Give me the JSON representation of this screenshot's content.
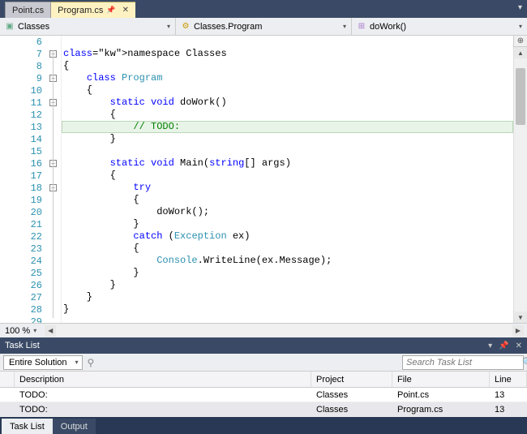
{
  "tabs": {
    "items": [
      {
        "label": "Point.cs",
        "active": false
      },
      {
        "label": "Program.cs",
        "active": true
      }
    ]
  },
  "nav": {
    "scope": "Classes",
    "class": "Classes.Program",
    "member": "doWork()"
  },
  "editor": {
    "zoom": "100 %",
    "first_line_no": 6,
    "highlight_line": 13,
    "lines": [
      {
        "n": 6,
        "raw": ""
      },
      {
        "n": 7,
        "raw": "namespace Classes",
        "outline": "-"
      },
      {
        "n": 8,
        "raw": "{"
      },
      {
        "n": 9,
        "raw": "    class Program",
        "outline": "-"
      },
      {
        "n": 10,
        "raw": "    {"
      },
      {
        "n": 11,
        "raw": "        static void doWork()",
        "outline": "-"
      },
      {
        "n": 12,
        "raw": "        {"
      },
      {
        "n": 13,
        "raw": "            // TODO:"
      },
      {
        "n": 14,
        "raw": "        }"
      },
      {
        "n": 15,
        "raw": ""
      },
      {
        "n": 16,
        "raw": "        static void Main(string[] args)",
        "outline": "-"
      },
      {
        "n": 17,
        "raw": "        {"
      },
      {
        "n": 18,
        "raw": "            try",
        "outline": "-"
      },
      {
        "n": 19,
        "raw": "            {"
      },
      {
        "n": 20,
        "raw": "                doWork();"
      },
      {
        "n": 21,
        "raw": "            }"
      },
      {
        "n": 22,
        "raw": "            catch (Exception ex)"
      },
      {
        "n": 23,
        "raw": "            {"
      },
      {
        "n": 24,
        "raw": "                Console.WriteLine(ex.Message);"
      },
      {
        "n": 25,
        "raw": "            }"
      },
      {
        "n": 26,
        "raw": "        }"
      },
      {
        "n": 27,
        "raw": "    }"
      },
      {
        "n": 28,
        "raw": "}"
      },
      {
        "n": 29,
        "raw": ""
      }
    ]
  },
  "tasklist": {
    "title": "Task List",
    "scope": "Entire Solution",
    "search_placeholder": "Search Task List",
    "columns": {
      "desc": "Description",
      "project": "Project",
      "file": "File",
      "line": "Line"
    },
    "rows": [
      {
        "desc": "TODO:",
        "project": "Classes",
        "file": "Point.cs",
        "line": "13",
        "selected": false
      },
      {
        "desc": "TODO:",
        "project": "Classes",
        "file": "Program.cs",
        "line": "13",
        "selected": true
      }
    ]
  },
  "bottom_tabs": {
    "items": [
      {
        "label": "Task List",
        "active": true
      },
      {
        "label": "Output",
        "active": false
      }
    ]
  }
}
